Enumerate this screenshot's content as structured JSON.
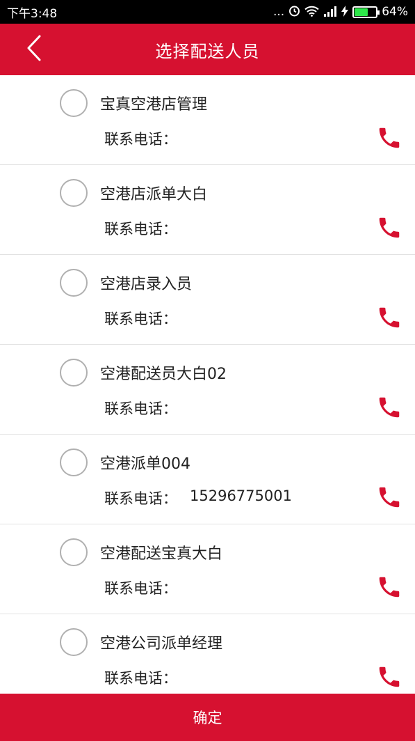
{
  "status_bar": {
    "time": "下午3:48",
    "dots": "...",
    "battery_text": "64%",
    "battery_level": 0.64,
    "icons": [
      "alarm-icon",
      "wifi-icon",
      "signal-icon",
      "charging-icon",
      "battery-icon"
    ]
  },
  "header": {
    "title": "选择配送人员",
    "back_icon": "chevron-left-icon"
  },
  "list": {
    "phone_label": "联系电话：",
    "items": [
      {
        "name": "宝真空港店管理",
        "phone": ""
      },
      {
        "name": "空港店派单大白",
        "phone": ""
      },
      {
        "name": "空港店录入员",
        "phone": ""
      },
      {
        "name": "空港配送员大白02",
        "phone": ""
      },
      {
        "name": "空港派单004",
        "phone": "15296775001"
      },
      {
        "name": "空港配送宝真大白",
        "phone": ""
      },
      {
        "name": "空港公司派单经理",
        "phone": ""
      }
    ]
  },
  "footer": {
    "confirm_label": "确定"
  },
  "colors": {
    "brand": "#d61130",
    "phone_icon": "#d61130",
    "radio_border": "#b0b0b0",
    "battery": "#2ee84a"
  }
}
